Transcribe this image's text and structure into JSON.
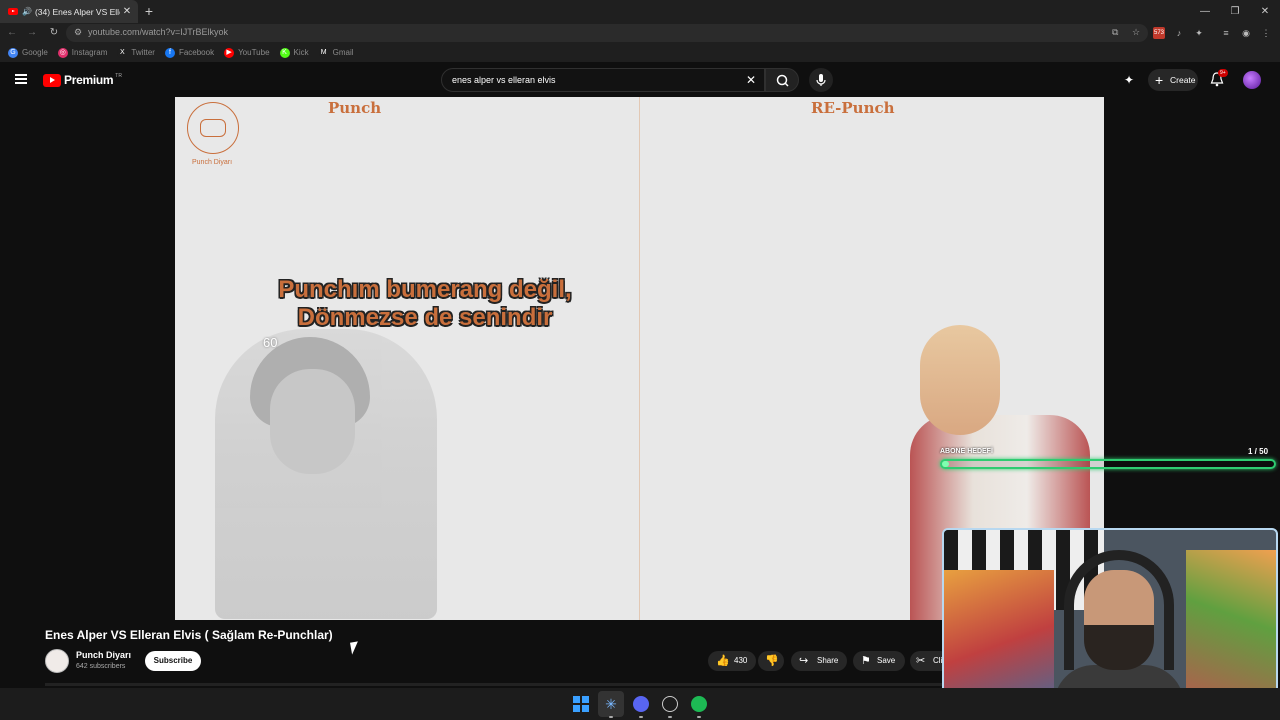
{
  "browser": {
    "tab_title": "(34) Enes Alper VS Elle",
    "tab_close": "✕",
    "new_tab": "+",
    "url": "youtube.com/watch?v=IJTrBElkyok",
    "window_controls": [
      "—",
      "❐",
      "✕"
    ],
    "bookmarks": [
      {
        "label": "Google",
        "icon": "google-icon",
        "color": "#4285f4",
        "glyph": "G"
      },
      {
        "label": "Instagram",
        "icon": "instagram-icon",
        "color": "#e1306c",
        "glyph": "◎"
      },
      {
        "label": "Twitter",
        "icon": "x-icon",
        "color": "#1f1f1f",
        "glyph": "X"
      },
      {
        "label": "Facebook",
        "icon": "facebook-icon",
        "color": "#1877f2",
        "glyph": "f"
      },
      {
        "label": "YouTube",
        "icon": "youtube-icon",
        "color": "#ff0000",
        "glyph": "▶"
      },
      {
        "label": "Kick",
        "icon": "kick-icon",
        "color": "#53fc18",
        "glyph": "K"
      },
      {
        "label": "Gmail",
        "icon": "gmail-icon",
        "color": "#1f1f1f",
        "glyph": "M"
      }
    ],
    "extension_badge": "573"
  },
  "youtube": {
    "logo_text": "Premium",
    "region": "TR",
    "search_query": "enes alper vs elleran elvis",
    "create_label": "Create",
    "notification_count": "9+"
  },
  "video": {
    "left_heading": "Punch",
    "right_heading": "RE-Punch",
    "channel_watermark": "Punch Diyarı",
    "punchline_line1": "Punchım bumerang değil,",
    "punchline_line2": "Dönmezse de senindir",
    "overlay_count": "60",
    "goal_label": "ABONE HEDEFİ",
    "goal_count": "1 / 50",
    "goal_progress": 0.02
  },
  "info": {
    "title": "Enes Alper VS Elleran Elvis ( Sağlam Re-Punchlar)",
    "channel": "Punch Diyarı",
    "subscribers": "642 subscribers",
    "subscribe_label": "Subscribe",
    "likes": "430",
    "share_label": "Share",
    "save_label": "Save",
    "clip_label": "Cli"
  },
  "colors": {
    "accent": "#c96f3c",
    "goal_bar": "#2ecc71"
  }
}
